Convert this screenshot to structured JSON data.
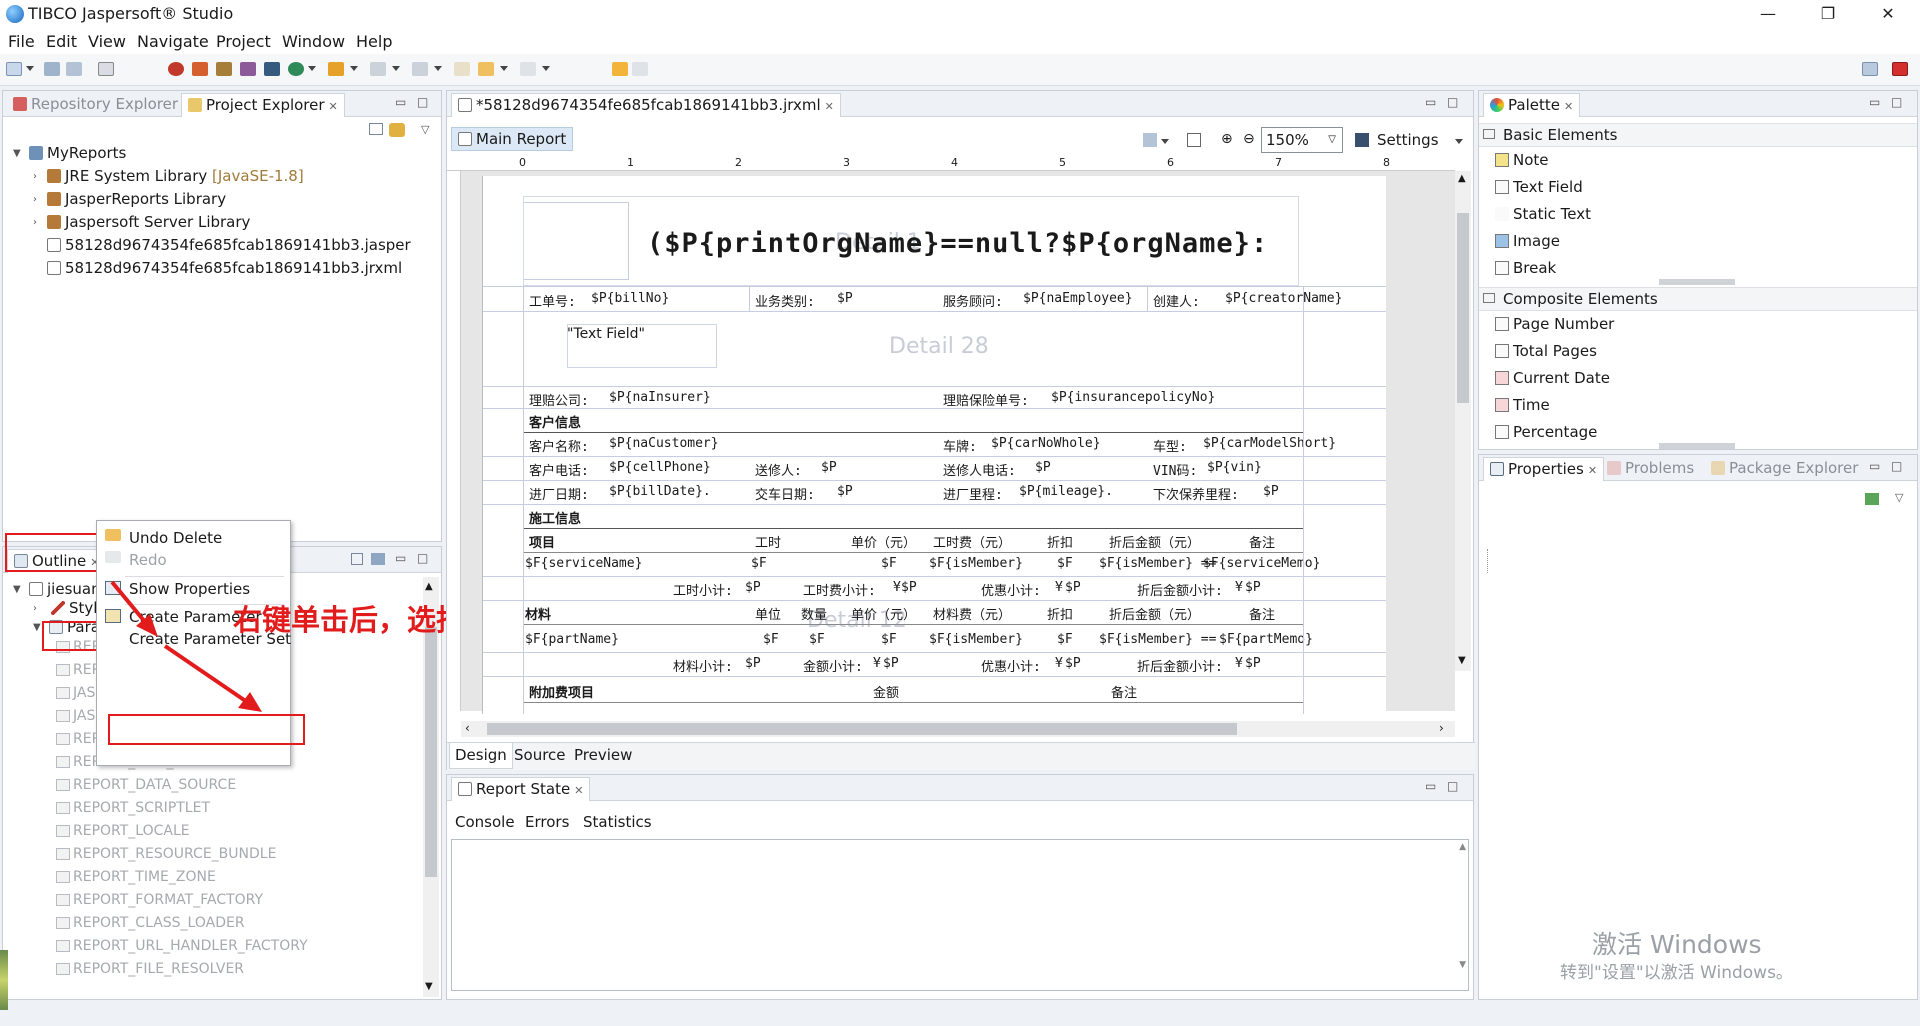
{
  "window": {
    "title": "TIBCO Jaspersoft® Studio",
    "minimize": "—",
    "maximize": "❐",
    "close": "✕"
  },
  "menu": [
    "File",
    "Edit",
    "View",
    "Navigate",
    "Project",
    "Window",
    "Help"
  ],
  "left_panel": {
    "tabs": [
      "Repository Explorer",
      "Project Explorer"
    ],
    "tree": {
      "root": "MyReports",
      "children": [
        "JRE System Library",
        "JasperReports Library",
        "Jaspersoft Server Library",
        "58128d9674354fe685fcab1869141bb3.jasper",
        "58128d9674354fe685fcab1869141bb3.jrxml"
      ],
      "jre_suffix": "[JavaSE-1.8]"
    }
  },
  "outline": {
    "tab": "Outline",
    "root": "jiesuandan",
    "styles": "Styles",
    "parameters": "Parame",
    "params": [
      "REPC",
      "REPC",
      "JASI",
      "JASI",
      "REPC",
      "REPORT_MAX_COUNT",
      "REPORT_DATA_SOURCE",
      "REPORT_SCRIPTLET",
      "REPORT_LOCALE",
      "REPORT_RESOURCE_BUNDLE",
      "REPORT_TIME_ZONE",
      "REPORT_FORMAT_FACTORY",
      "REPORT_CLASS_LOADER",
      "REPORT_URL_HANDLER_FACTORY",
      "REPORT_FILE_RESOLVER"
    ]
  },
  "context_menu": [
    "Undo Delete",
    "Redo",
    "Show Properties",
    "Create Parameter",
    "Create Parameter Set"
  ],
  "annotation": "右键单击后，选择新增",
  "editor": {
    "file_tab": "*58128d9674354fe685fcab1869141bb3.jrxml",
    "main_report": "Main Report",
    "zoom": "150%",
    "settings": "Settings",
    "bottom_tabs": [
      "Design",
      "Source",
      "Preview"
    ],
    "ruler": [
      "0",
      "1",
      "2",
      "3",
      "4",
      "5",
      "6",
      "7",
      "8"
    ]
  },
  "report": {
    "title_expr": "($P{printOrgName}==null?$P{orgName}:",
    "detail1": "Detail 1",
    "detail28": "Detail 28",
    "detail12": "Detail 12",
    "text_field": "\"Text Field\"",
    "row1": [
      "工单号:",
      "$P{billNo}",
      "业务类别:",
      "$P",
      "服务顾问:",
      "$P{naEmployee}",
      "创建人:",
      "$P{creatorName}"
    ],
    "row2": [
      "理赔公司:",
      "$P{naInsurer}",
      "理赔保险单号:",
      "$P{insurancepolicyNo}"
    ],
    "customer_header": "客户信息",
    "row3": [
      "客户名称:",
      "$P{naCustomer}",
      "车牌:",
      "$P{carNoWhole}",
      "车型:",
      "$P{carModelShort}"
    ],
    "row4": [
      "客户电话:",
      "$P{cellPhone}",
      "送修人:",
      "$P",
      "送修人电话:",
      "$P",
      "VIN码:",
      "$P{vin}"
    ],
    "row5": [
      "进厂日期:",
      "$P{billDate}.",
      "交车日期:",
      "$P",
      "进厂里程:",
      "$P{mileage}.",
      "下次保养里程:",
      "$P"
    ],
    "construction_header": "施工信息",
    "svc_head": [
      "项目",
      "工时",
      "单价（元）",
      "工时费（元）",
      "折扣",
      "折后金额（元）",
      "备注"
    ],
    "svc_row": [
      "$F{serviceName}",
      "$F",
      "$F",
      "$F{isMember}",
      "$F",
      "$F{isMember} ==",
      "$F{serviceMemo}"
    ],
    "svc_sub": [
      "工时小计:",
      "$P",
      "工时费小计:",
      "¥",
      "$P",
      "优惠小计:",
      "¥",
      "$P",
      "折后金额小计:",
      "¥",
      "$P"
    ],
    "mat_head": [
      "材料",
      "单位",
      "数量",
      "单价（元）",
      "材料费（元）",
      "折扣",
      "折后金额（元）",
      "备注"
    ],
    "mat_row": [
      "$F{partName}",
      "$F",
      "$F",
      "$F",
      "$F{isMember}",
      "$F",
      "$F{isMember} ==",
      "$F{partMemo}"
    ],
    "mat_sub": [
      "材料小计:",
      "$P",
      "金额小计:",
      "¥",
      "$P",
      "优惠小计:",
      "¥",
      "$P",
      "折后金额小计:",
      "¥",
      "$P"
    ],
    "extra": [
      "附加费项目",
      "金额",
      "备注"
    ]
  },
  "palette": {
    "tab": "Palette",
    "basic_header": "Basic Elements",
    "basic": [
      "Note",
      "Text Field",
      "Static Text",
      "Image",
      "Break"
    ],
    "composite_header": "Composite Elements",
    "composite": [
      "Page Number",
      "Total Pages",
      "Current Date",
      "Time",
      "Percentage"
    ]
  },
  "properties": {
    "tabs": [
      "Properties",
      "Problems",
      "Package Explorer"
    ]
  },
  "report_state": {
    "tab": "Report State",
    "tabs": [
      "Console",
      "Errors",
      "Statistics"
    ]
  },
  "watermark": {
    "line1": "激活 Windows",
    "line2": "转到\"设置\"以激活 Windows。"
  }
}
